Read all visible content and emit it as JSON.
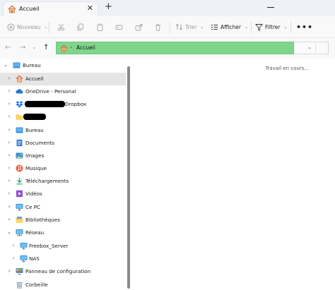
{
  "tab": {
    "title": "Accueil",
    "close_glyph": "✕",
    "icon": "home-icon"
  },
  "new_tab_glyph": "+",
  "toolbar": {
    "new_label": "Nouveau",
    "sort_label": "Trier",
    "view_label": "Afficher",
    "filter_label": "Filtrer",
    "more_glyph": "•••",
    "icons": [
      "plus-icon",
      "cut-icon",
      "copy-icon",
      "paste-icon",
      "rename-icon",
      "share-icon",
      "delete-icon",
      "sort-icon",
      "view-icon",
      "filter-icon"
    ]
  },
  "nav": {
    "back": "←",
    "forward": "→",
    "recent": "⌄",
    "up": "↑"
  },
  "address": {
    "separator": "›",
    "current": "Accueil",
    "dropdown_glyph": "⌄",
    "highlight_color": "#7fd68a"
  },
  "tree": {
    "items": [
      {
        "label": "Bureau",
        "expander": "⌄",
        "icon": "desktop-icon"
      },
      {
        "label": "Accueil",
        "expander": "›",
        "icon": "home-icon",
        "selected": true
      },
      {
        "label": "OneDrive - Personal",
        "expander": "›",
        "icon": "cloud-icon"
      },
      {
        "label": "Dropbox",
        "expander": "›",
        "icon": "dropbox-icon"
      },
      {
        "label": "",
        "expander": "›",
        "icon": "folder-icon"
      },
      {
        "label": "Bureau",
        "expander": "›",
        "icon": "desktop-icon"
      },
      {
        "label": "Documents",
        "expander": "›",
        "icon": "documents-icon"
      },
      {
        "label": "Images",
        "expander": "›",
        "icon": "pictures-icon"
      },
      {
        "label": "Musique",
        "expander": "›",
        "icon": "music-icon"
      },
      {
        "label": "Téléchargements",
        "expander": "›",
        "icon": "download-icon"
      },
      {
        "label": "Vidéos",
        "expander": "›",
        "icon": "video-icon"
      },
      {
        "label": "Ce PC",
        "expander": "›",
        "icon": "pc-icon"
      },
      {
        "label": "Bibliothèques",
        "expander": "›",
        "icon": "libraries-icon"
      },
      {
        "label": "Réseau",
        "expander": "⌄",
        "icon": "network-icon"
      },
      {
        "label": "Freebox_Server",
        "expander": "›",
        "icon": "computer-icon"
      },
      {
        "label": "NAS",
        "expander": "›",
        "icon": "computer-icon"
      },
      {
        "label": "Panneau de configuration",
        "expander": "›",
        "icon": "control-panel-icon"
      },
      {
        "label": "Corbeille",
        "expander": "",
        "icon": "recycle-bin-icon"
      }
    ]
  },
  "content": {
    "status": "Travail en cours..."
  }
}
